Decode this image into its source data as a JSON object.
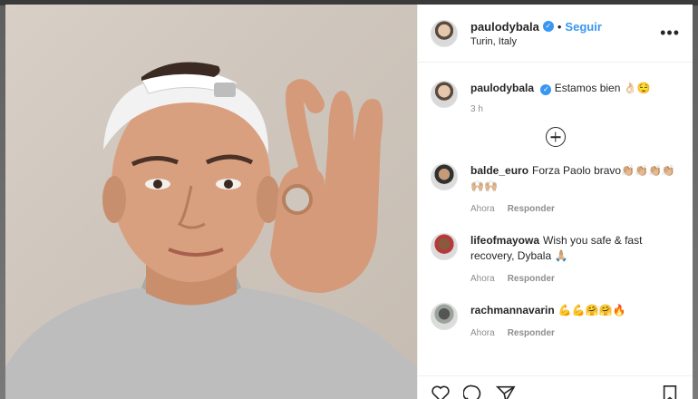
{
  "post": {
    "username": "paulodybala",
    "follow_label": "Seguir",
    "location": "Turin, Italy",
    "more_label": "•••",
    "caption_text": "Estamos bien 👌🏻😌",
    "caption_time": "3 h"
  },
  "comments": [
    {
      "user": "balde_euro",
      "text": "Forza Paolo bravo👏🏼👏🏼👏🏼👏🏼🙌🏼🙌🏼",
      "time": "Ahora",
      "reply_label": "Responder"
    },
    {
      "user": "lifeofmayowa",
      "text": "Wish you safe & fast recovery, Dybala 🙏🏼",
      "time": "Ahora",
      "reply_label": "Responder"
    },
    {
      "user": "rachmannavarin",
      "text": "💪💪🤗🤗🔥",
      "time": "Ahora",
      "reply_label": "Responder"
    }
  ],
  "icons": {
    "verified": "verified-badge-icon",
    "load_more": "plus-circle-icon",
    "like": "heart-icon",
    "comment": "comment-icon",
    "share": "paper-plane-icon",
    "save": "bookmark-icon"
  },
  "colors": {
    "accent": "#3897f0",
    "text": "#262626",
    "muted": "#8e8e8e"
  }
}
